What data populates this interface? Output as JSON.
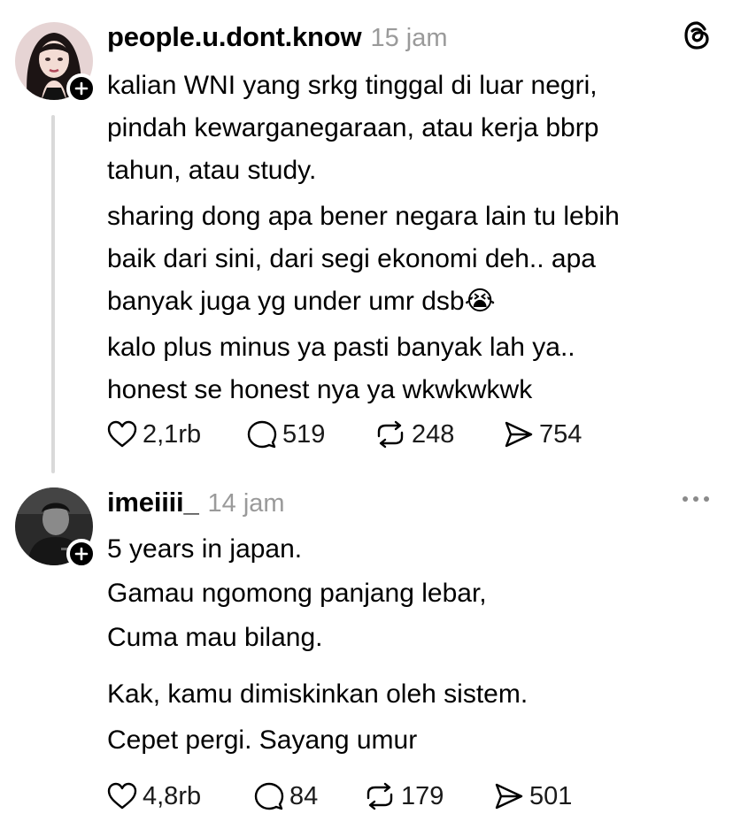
{
  "posts": [
    {
      "username": "people.u.dont.know",
      "time": "15 jam",
      "lines": [
        "kalian WNI yang srkg tinggal di luar negri,",
        "pindah kewarganegaraan, atau kerja bbrp",
        "tahun, atau study.",
        "sharing dong apa bener negara lain tu lebih",
        "baik dari sini, dari segi ekonomi deh.. apa",
        "banyak juga yg under umr dsb😭",
        "kalo plus minus ya pasti banyak lah ya..",
        "honest se honest nya ya wkwkwkwk"
      ],
      "likes": "2,1rb",
      "replies": "519",
      "reposts": "248",
      "shares": "754"
    },
    {
      "username": "imeiiii_",
      "time": "14 jam",
      "lines": [
        "5 years in japan.",
        "Gamau ngomong panjang lebar,",
        "Cuma mau bilang.",
        "Kak, kamu dimiskinkan oleh sistem.",
        "Cepet pergi. Sayang umur"
      ],
      "likes": "4,8rb",
      "replies": "84",
      "reposts": "179",
      "shares": "501"
    }
  ],
  "icons": {
    "app_logo": "threads-logo-icon",
    "more": "more-dots-icon",
    "like": "heart-icon",
    "reply": "comment-icon",
    "repost": "repost-icon",
    "share": "share-icon",
    "follow": "plus-icon"
  },
  "colors": {
    "text": "#000000",
    "muted": "#9a9a9a",
    "thread_line": "#d9d9d9"
  }
}
